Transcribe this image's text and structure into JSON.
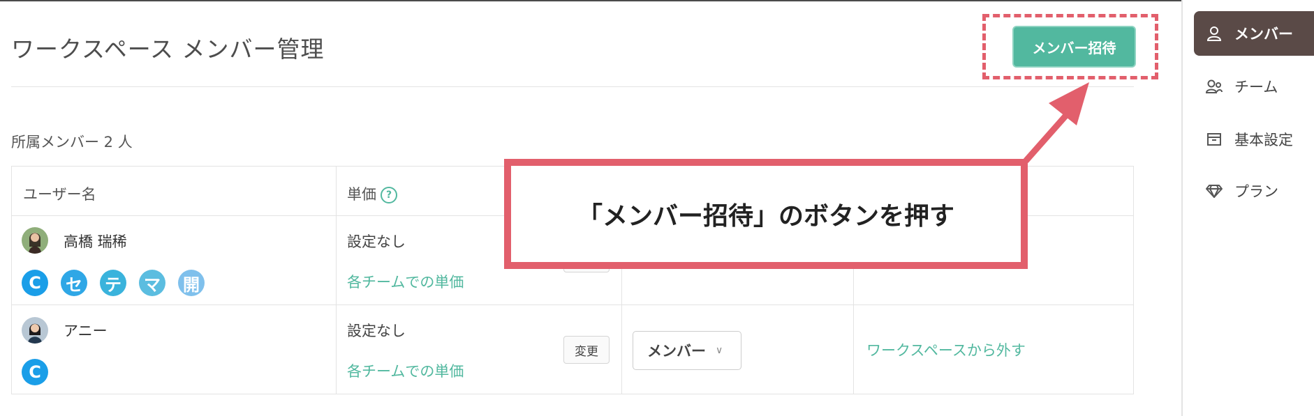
{
  "header": {
    "title": "ワークスペース メンバー管理",
    "invite_button": "メンバー招待"
  },
  "members_section": {
    "count_label": "所属メンバー 2 人",
    "columns": {
      "user_name": "ユーザー名",
      "unit_price": "単価",
      "help": "?"
    },
    "rows": [
      {
        "name": "高橋 瑞稀",
        "price": "設定なし",
        "team_price_link": "各チームでの単価",
        "badges": [
          "C",
          "セ",
          "テ",
          "マ",
          "開"
        ]
      },
      {
        "name": "アニー",
        "price": "設定なし",
        "team_price_link": "各チームでの単価",
        "change_button": "変更",
        "role": "メンバー",
        "remove_link": "ワークスペースから外す",
        "badges": [
          "C"
        ]
      }
    ]
  },
  "annotation": {
    "callout_text": "「メンバー招待」のボタンを押す"
  },
  "sidebar": {
    "items": [
      {
        "label": "メンバー",
        "icon": "user-icon",
        "active": true
      },
      {
        "label": "チーム",
        "icon": "team-icon",
        "active": false
      },
      {
        "label": "基本設定",
        "icon": "settings-box-icon",
        "active": false
      },
      {
        "label": "プラン",
        "icon": "diamond-icon",
        "active": false
      }
    ]
  },
  "colors": {
    "accent": "#52b89f",
    "annotation": "#e25f6c",
    "sidebar_active": "#5a4a47"
  }
}
